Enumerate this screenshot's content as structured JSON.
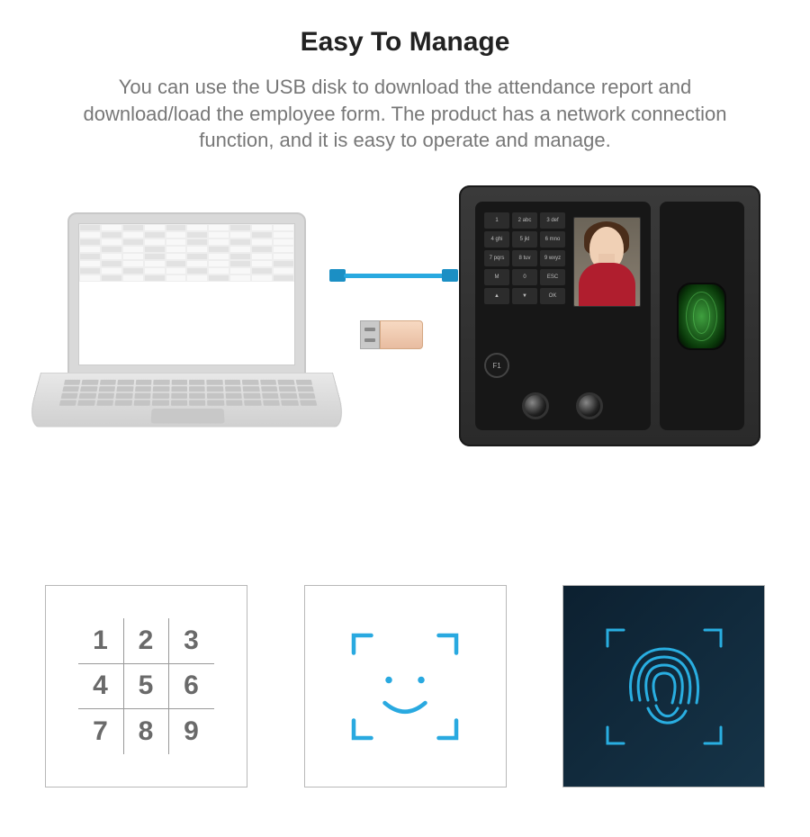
{
  "title": "Easy To Manage",
  "description": "You can use the USB disk to download the attendance report and download/load the employee form. The product has a network connection function, and it is easy to operate and manage.",
  "device": {
    "keypad": [
      "1",
      "2 abc",
      "3 def",
      "4 ghi",
      "5 jkl",
      "6 mno",
      "7 pqrs",
      "8 tuv",
      "9 wxyz",
      "M",
      "0",
      "ESC",
      "▲",
      "▼",
      "OK"
    ],
    "f1_label": "F1"
  },
  "features": {
    "numpad": [
      "1",
      "2",
      "3",
      "4",
      "5",
      "6",
      "7",
      "8",
      "9"
    ]
  },
  "colors": {
    "accent_blue": "#29a9e0",
    "device_dark": "#2a2a2a"
  }
}
